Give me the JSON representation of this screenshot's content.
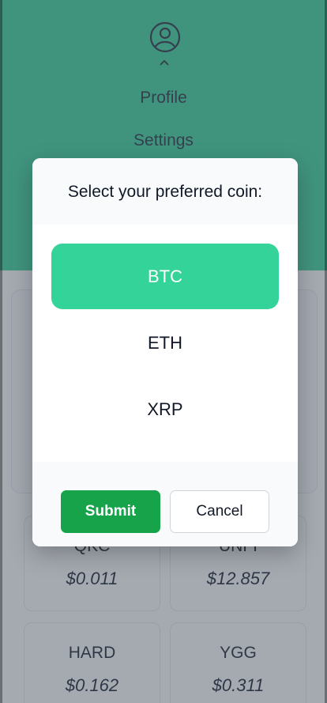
{
  "header": {
    "nav": [
      "Profile",
      "Settings"
    ]
  },
  "coins": [
    {
      "symbol": "QKC",
      "price": "$0.011"
    },
    {
      "symbol": "UNFI",
      "price": "$12.857"
    },
    {
      "symbol": "HARD",
      "price": "$0.162"
    },
    {
      "symbol": "YGG",
      "price": "$0.311"
    }
  ],
  "modal": {
    "title": "Select your preferred coin:",
    "options": [
      {
        "label": "BTC",
        "selected": true
      },
      {
        "label": "ETH",
        "selected": false
      },
      {
        "label": "XRP",
        "selected": false
      }
    ],
    "submit_label": "Submit",
    "cancel_label": "Cancel"
  },
  "colors": {
    "accent": "#34d399",
    "submit": "#16a34a"
  }
}
